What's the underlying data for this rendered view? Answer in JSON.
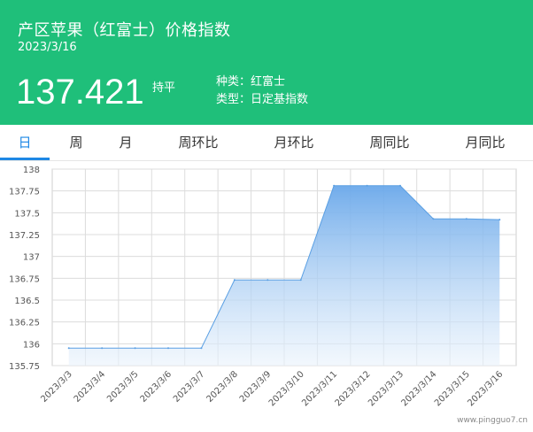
{
  "header": {
    "title": "产区苹果（红富士）价格指数",
    "date": "2023/3/16",
    "value": "137.421",
    "change": "持平",
    "variety": "种类：红富士",
    "type": "类型：日定基指数"
  },
  "tabs": [
    {
      "label": "日",
      "active": true
    },
    {
      "label": "周",
      "active": false
    },
    {
      "label": "月",
      "active": false
    },
    {
      "label": "周环比",
      "active": false
    },
    {
      "label": "月环比",
      "active": false
    },
    {
      "label": "周同比",
      "active": false
    },
    {
      "label": "月同比",
      "active": false
    }
  ],
  "colors": {
    "header_bg": "#1fbf7a",
    "active_tab": "#1e88e5",
    "area_top": "#7fb4ec",
    "line": "#5a9fe3"
  },
  "watermark": "www.pingguo7.cn",
  "chart_data": {
    "type": "area",
    "title": "",
    "xlabel": "",
    "ylabel": "",
    "x": [
      "2023/3/3",
      "2023/3/4",
      "2023/3/5",
      "2023/3/6",
      "2023/3/7",
      "2023/3/8",
      "2023/3/9",
      "2023/3/10",
      "2023/3/11",
      "2023/3/12",
      "2023/3/13",
      "2023/3/14",
      "2023/3/15",
      "2023/3/16"
    ],
    "values": [
      135.95,
      135.95,
      135.95,
      135.95,
      135.95,
      136.73,
      136.73,
      136.73,
      137.81,
      137.81,
      137.81,
      137.43,
      137.43,
      137.421
    ],
    "yticks": [
      "138",
      "137.75",
      "137.5",
      "137.25",
      "137",
      "136.75",
      "136.5",
      "136.25",
      "136",
      "135.75"
    ],
    "ylim": [
      135.75,
      138
    ],
    "grid": true
  }
}
